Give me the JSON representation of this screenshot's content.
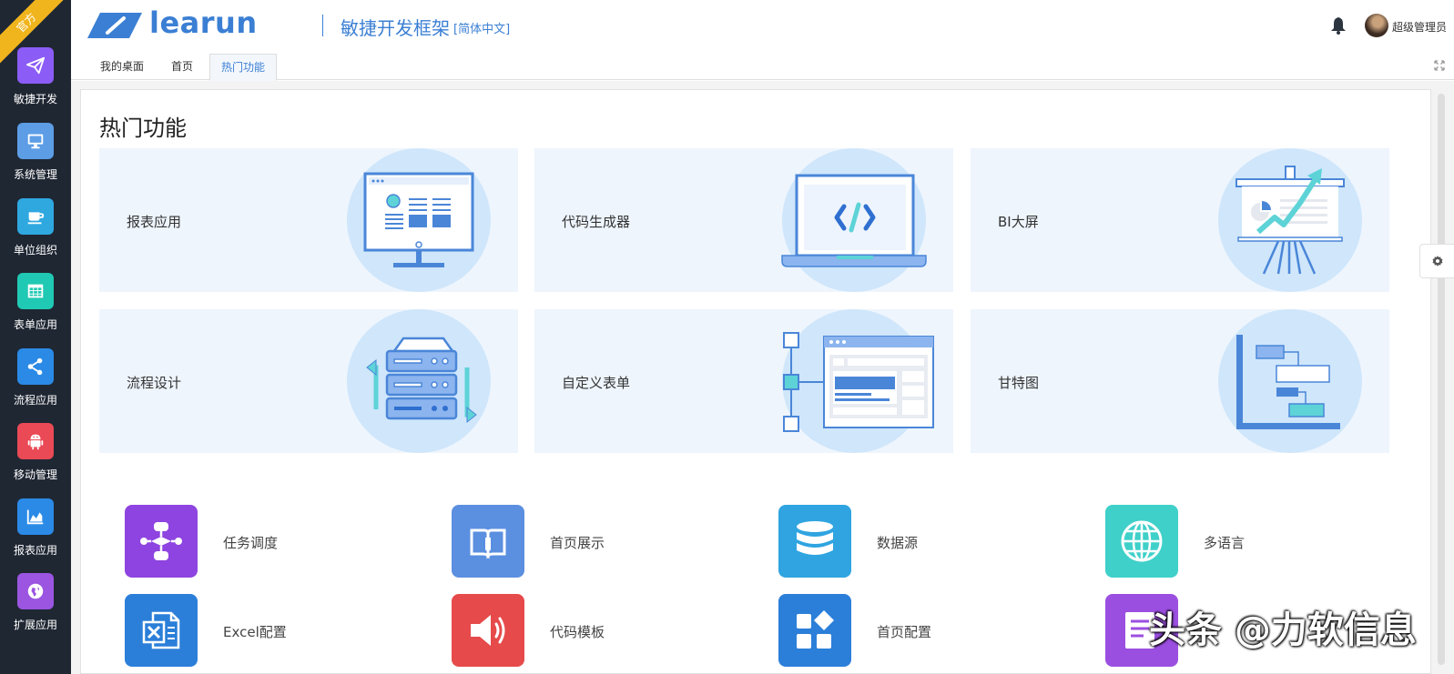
{
  "sidebar": {
    "ribbon": "官方",
    "items": [
      {
        "label": "敏捷开发",
        "icon": "paper-plane-icon",
        "color": "#8b5cf6"
      },
      {
        "label": "系统管理",
        "icon": "monitor-icon",
        "color": "#5c9de6"
      },
      {
        "label": "单位组织",
        "icon": "coffee-cup-icon",
        "color": "#2fa8e0"
      },
      {
        "label": "表单应用",
        "icon": "table-icon",
        "color": "#20c9b3"
      },
      {
        "label": "流程应用",
        "icon": "share-nodes-icon",
        "color": "#2b8ae6"
      },
      {
        "label": "移动管理",
        "icon": "android-icon",
        "color": "#e94a55"
      },
      {
        "label": "报表应用",
        "icon": "area-chart-icon",
        "color": "#2b8ae6"
      },
      {
        "label": "扩展应用",
        "icon": "globe-icon",
        "color": "#9b55e0"
      }
    ]
  },
  "header": {
    "logo_text": "learun",
    "subtitle": "敏捷开发框架",
    "language": "[简体中文]",
    "username": "超级管理员",
    "accent": "#3b7fd4"
  },
  "tabs": [
    {
      "label": "我的桌面",
      "active": false
    },
    {
      "label": "首页",
      "active": false
    },
    {
      "label": "热门功能",
      "active": true
    }
  ],
  "page": {
    "title": "热门功能",
    "cards": [
      {
        "label": "报表应用",
        "icon": "monitor-report-icon"
      },
      {
        "label": "代码生成器",
        "icon": "laptop-code-icon"
      },
      {
        "label": "BI大屏",
        "icon": "presentation-chart-icon"
      },
      {
        "label": "流程设计",
        "icon": "server-cycle-icon"
      },
      {
        "label": "自定义表单",
        "icon": "form-layout-icon"
      },
      {
        "label": "甘特图",
        "icon": "gantt-chart-icon"
      }
    ],
    "features": [
      {
        "label": "任务调度",
        "icon": "flowchart-icon",
        "color": "#8e44e0"
      },
      {
        "label": "首页展示",
        "icon": "book-icon",
        "color": "#5b8fe0"
      },
      {
        "label": "数据源",
        "icon": "database-icon",
        "color": "#2fa4e0"
      },
      {
        "label": "多语言",
        "icon": "globe-icon",
        "color": "#3fd0c9"
      },
      {
        "label": "Excel配置",
        "icon": "excel-icon",
        "color": "#2b7fd9"
      },
      {
        "label": "代码模板",
        "icon": "speaker-icon",
        "color": "#e64a4a"
      },
      {
        "label": "首页配置",
        "icon": "widgets-icon",
        "color": "#2b7fd9"
      },
      {
        "label": "",
        "icon": "document-icon",
        "color": "#9b4fe0"
      }
    ]
  },
  "watermark": "头条 @力软信息"
}
